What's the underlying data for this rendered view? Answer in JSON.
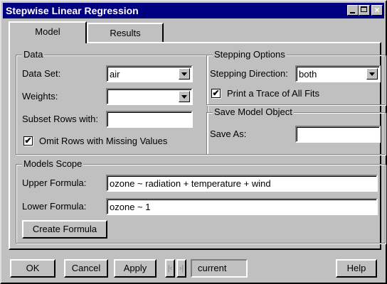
{
  "window": {
    "title": "Stepwise Linear Regression"
  },
  "tabs": [
    {
      "label": "Model",
      "active": true
    },
    {
      "label": "Results",
      "active": false
    }
  ],
  "data_group": {
    "title": "Data",
    "data_set": {
      "label": "Data Set:",
      "value": "air"
    },
    "weights": {
      "label": "Weights:",
      "value": ""
    },
    "subset_rows": {
      "label": "Subset Rows with:",
      "value": ""
    },
    "omit_rows": {
      "label": "Omit Rows with Missing Values",
      "checked": true
    }
  },
  "stepping_group": {
    "title": "Stepping Options",
    "direction": {
      "label": "Stepping Direction:",
      "value": "both"
    },
    "print_trace": {
      "label": "Print a Trace of All Fits",
      "checked": true
    }
  },
  "save_group": {
    "title": "Save Model Object",
    "save_as": {
      "label": "Save As:",
      "value": ""
    }
  },
  "scope_group": {
    "title": "Models Scope",
    "upper": {
      "label": "Upper Formula:",
      "value": "ozone ~ radiation + temperature + wind"
    },
    "lower": {
      "label": "Lower Formula:",
      "value": "ozone ~ 1"
    },
    "create_formula": "Create Formula"
  },
  "footer": {
    "ok": "OK",
    "cancel": "Cancel",
    "apply": "Apply",
    "current": "current",
    "help": "Help"
  },
  "icons": [
    "minimize-icon",
    "maximize-icon",
    "close-icon",
    "chevron-down-icon",
    "checkmark-icon",
    "prev-arrow-icon",
    "next-arrow-icon"
  ]
}
